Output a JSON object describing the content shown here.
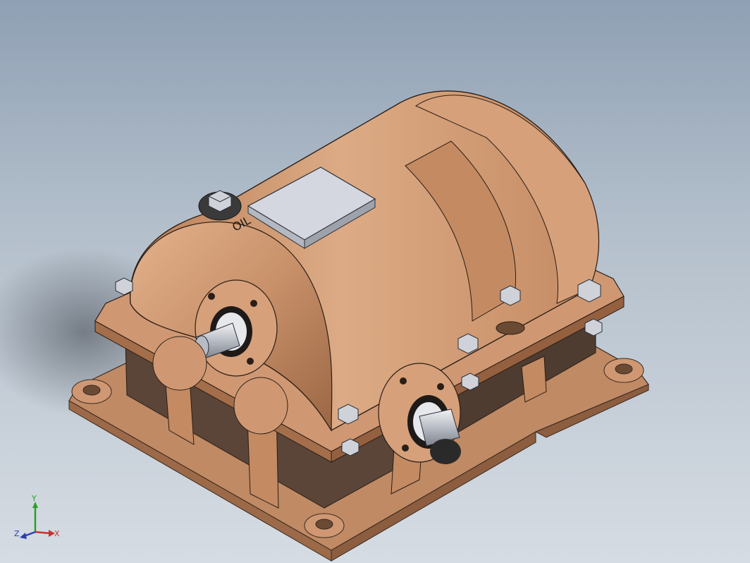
{
  "model": {
    "housing_label": "OIL"
  },
  "triad": {
    "x_label": "X",
    "y_label": "Y",
    "z_label": "Z"
  },
  "colors": {
    "housing": "#c8916a",
    "housing_light": "#dba57f",
    "housing_dark": "#8a5a3c",
    "shadow": "#54463c",
    "steel": "#c8ccd2",
    "plate": "#d4d7e0",
    "x_axis": "#c83232",
    "y_axis": "#28a028",
    "z_axis": "#2b3fb0"
  }
}
